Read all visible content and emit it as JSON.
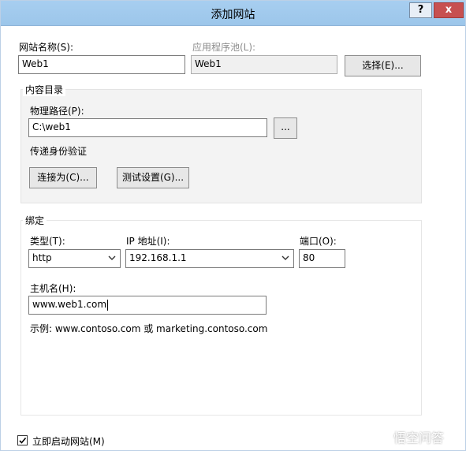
{
  "window": {
    "title": "添加网站",
    "help_label": "?",
    "close_label": "x"
  },
  "site": {
    "name_label": "网站名称(S):",
    "name_value": "Web1",
    "app_pool_label": "应用程序池(L):",
    "app_pool_value": "Web1",
    "select_button": "选择(E)..."
  },
  "content_dir": {
    "group_title": "内容目录",
    "physical_path_label": "物理路径(P):",
    "physical_path_value": "C:\\web1",
    "browse_button": "...",
    "pass_auth_label": "传递身份验证",
    "connect_as_button": "连接为(C)...",
    "test_settings_button": "测试设置(G)..."
  },
  "binding": {
    "group_title": "绑定",
    "type_label": "类型(T):",
    "type_value": "http",
    "ip_label": "IP 地址(I):",
    "ip_value": "192.168.1.1",
    "port_label": "端口(O):",
    "port_value": "80",
    "hostname_label": "主机名(H):",
    "hostname_value": "www.web1.com",
    "example_text": "示例: www.contoso.com 或 marketing.contoso.com"
  },
  "start_now": {
    "label": "立即启动网站(M)",
    "checked": true
  },
  "watermark": {
    "text": "悟空问答"
  }
}
